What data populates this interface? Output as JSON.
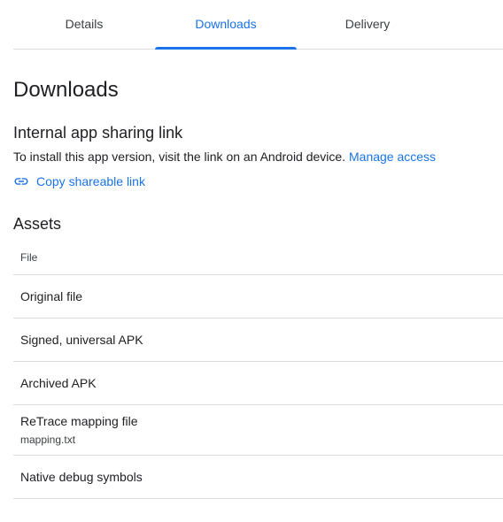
{
  "tabs": [
    {
      "label": "Details",
      "active": false
    },
    {
      "label": "Downloads",
      "active": true
    },
    {
      "label": "Delivery",
      "active": false
    }
  ],
  "page": {
    "title": "Downloads"
  },
  "sharing": {
    "title": "Internal app sharing link",
    "description": "To install this app version, visit the link on an Android device.",
    "manage_access_label": "Manage access",
    "copy_link_label": "Copy shareable link",
    "copy_link_icon": "link-icon"
  },
  "assets": {
    "title": "Assets",
    "column_header": "File",
    "rows": [
      {
        "name": "Original file",
        "subtext": ""
      },
      {
        "name": "Signed, universal APK",
        "subtext": ""
      },
      {
        "name": "Archived APK",
        "subtext": ""
      },
      {
        "name": "ReTrace mapping file",
        "subtext": "mapping.txt"
      },
      {
        "name": "Native debug symbols",
        "subtext": ""
      }
    ]
  },
  "colors": {
    "accent": "#1a73e8",
    "text": "#202124",
    "divider": "#dadce0"
  }
}
